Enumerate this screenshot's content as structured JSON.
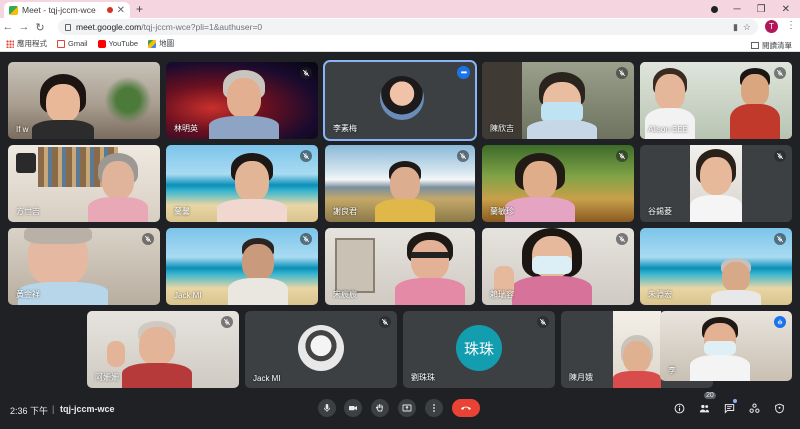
{
  "browser": {
    "tab_title": "Meet - tqj-jccm-wce",
    "url_host": "meet.google.com",
    "url_path": "/tqj-jccm-wce?pli=1&authuser=0",
    "profile_initial": "T",
    "bookmarks": [
      {
        "label": "應用程式",
        "icon": "apps-icon"
      },
      {
        "label": "Gmail",
        "icon": "gmail-icon"
      },
      {
        "label": "YouTube",
        "icon": "youtube-icon"
      },
      {
        "label": "地圖",
        "icon": "maps-icon"
      }
    ],
    "reading_list": "閱讀清單"
  },
  "meeting": {
    "time": "2:36 下午",
    "code": "tqj-jccm-wce",
    "participant_count": "20",
    "colors": {
      "hangup": "#ea4335",
      "accent": "#1a73e8",
      "avatar_teal": "#129eaf"
    }
  },
  "participants": [
    {
      "name": "If w",
      "muted": false
    },
    {
      "name": "林明英",
      "muted": true
    },
    {
      "name": "李素梅",
      "muted": false,
      "active": true
    },
    {
      "name": "陳欣吉",
      "muted": true
    },
    {
      "name": "Alison EEE",
      "muted": true
    },
    {
      "name": "方世吉",
      "muted": false
    },
    {
      "name": "蘭馨",
      "muted": true
    },
    {
      "name": "謝良君",
      "muted": true
    },
    {
      "name": "蘭敏珍",
      "muted": true
    },
    {
      "name": "谷錫菱",
      "muted": true
    },
    {
      "name": "黃金祥",
      "muted": true
    },
    {
      "name": "Jack MI",
      "muted": true
    },
    {
      "name": "宋宸宸",
      "muted": false
    },
    {
      "name": "賴瑞容",
      "muted": true
    },
    {
      "name": "朱淵宏",
      "muted": true
    },
    {
      "name": "阿姍姍",
      "muted": true
    },
    {
      "name": "Jack MI",
      "muted": true
    },
    {
      "name": "劉珠珠",
      "muted": true,
      "avatar_text": "珠珠"
    },
    {
      "name": "陳月娥",
      "muted": true
    },
    {
      "name": "李",
      "muted": false,
      "speaking": true
    }
  ]
}
